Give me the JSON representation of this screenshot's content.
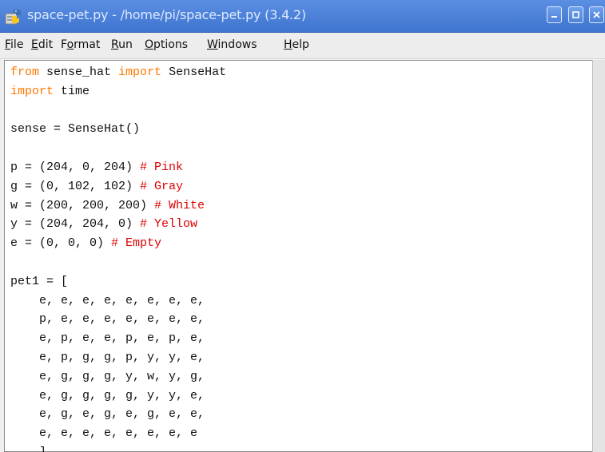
{
  "window": {
    "title": "space-pet.py - /home/pi/space-pet.py (3.4.2)",
    "minimize_symbol": "minimize-icon",
    "maximize_symbol": "maximize-icon",
    "close_symbol": "close-icon"
  },
  "menu": {
    "items": [
      {
        "first": "F",
        "rest": "ile"
      },
      {
        "first": "E",
        "rest": "dit"
      },
      {
        "pre": "F",
        "first": "o",
        "rest": "rmat"
      },
      {
        "first": "R",
        "rest": "un"
      },
      {
        "first": "O",
        "rest": "ptions"
      },
      {
        "first": "W",
        "rest": "indows"
      },
      {
        "first": "H",
        "rest": "elp"
      }
    ]
  },
  "code": {
    "line1": {
      "kw1": "from",
      "mid": " sense_hat ",
      "kw2": "import",
      "tail": " SenseHat"
    },
    "line2": {
      "kw": "import",
      "tail": " time"
    },
    "line4": "sense = SenseHat()",
    "line6": {
      "code": "p = (204, 0, 204) ",
      "comment": "# Pink"
    },
    "line7": {
      "code": "g = (0, 102, 102) ",
      "comment": "# Gray"
    },
    "line8": {
      "code": "w = (200, 200, 200) ",
      "comment": "# White"
    },
    "line9": {
      "code": "y = (204, 204, 0) ",
      "comment": "# Yellow"
    },
    "line10": {
      "code": "e = (0, 0, 0) ",
      "comment": "# Empty"
    },
    "line12": "pet1 = [",
    "line13": "    e, e, e, e, e, e, e, e,",
    "line14": "    p, e, e, e, e, e, e, e,",
    "line15": "    e, p, e, e, p, e, p, e,",
    "line16": "    e, p, g, g, p, y, y, e,",
    "line17": "    e, g, g, g, y, w, y, g,",
    "line18": "    e, g, g, g, g, y, y, e,",
    "line19": "    e, g, e, g, e, g, e, e,",
    "line20": "    e, e, e, e, e, e, e, e",
    "line21": "    ]"
  },
  "colors": {
    "titlebar": "#4a80da",
    "keyword": "#ff7700",
    "comment": "#dd0000"
  }
}
